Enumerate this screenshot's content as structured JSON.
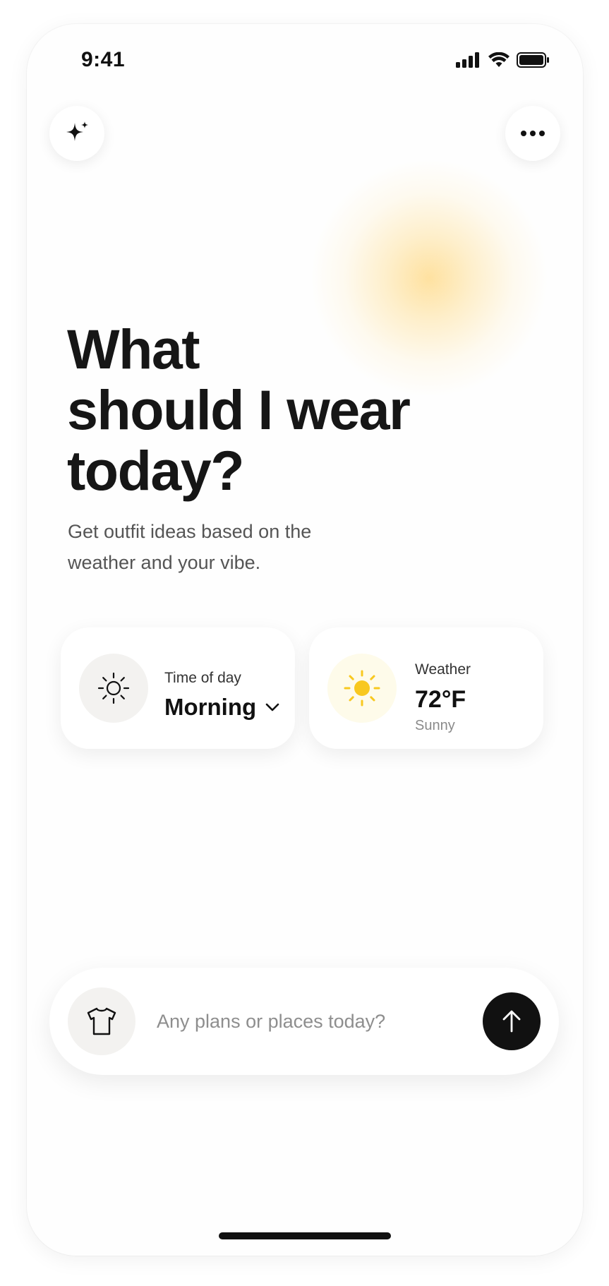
{
  "status_bar": {
    "time": "9:41",
    "icons": [
      "cellular-signal-icon",
      "wifi-icon",
      "battery-icon"
    ]
  },
  "toolbar": {
    "left_icon": "sparkle-icon",
    "right_icon": "more-horizontal-icon"
  },
  "hero": {
    "title_lines": [
      "What",
      "should I wear",
      "today?"
    ],
    "subtitle_lines": [
      "Get outfit ideas based on the",
      "weather and your vibe."
    ]
  },
  "time_card": {
    "icon": "sun-outline-icon",
    "label": "Time of day",
    "value": "Morning"
  },
  "weather_card": {
    "icon": "sun-filled-icon",
    "label": "Weather",
    "temperature": "72°F",
    "condition": "Sunny"
  },
  "prompt": {
    "icon": "shirt-icon",
    "placeholder": "Any plans or places today?",
    "value": "",
    "send_icon": "arrow-up-icon"
  },
  "colors": {
    "text_primary": "#161616",
    "text_secondary": "#555555",
    "accent_sun": "#f8c81f",
    "glow": "#ffd56e",
    "button_dark": "#111111"
  }
}
